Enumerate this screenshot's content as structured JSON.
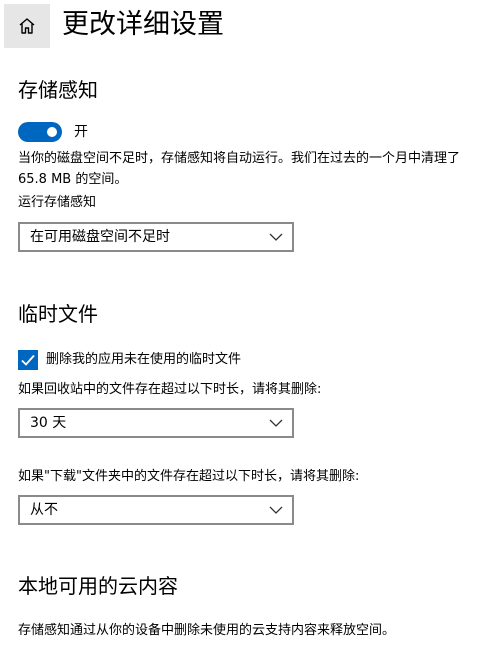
{
  "header": {
    "title": "更改详细设置"
  },
  "storage_sense": {
    "title": "存储感知",
    "toggle_state_label": "开",
    "description": "当你的磁盘空间不足时，存储感知将自动运行。我们在过去的一个月中清理了 65.8 MB 的空间。",
    "run_label": "运行存储感知",
    "run_value": "在可用磁盘空间不足时"
  },
  "temp_files": {
    "title": "临时文件",
    "checkbox_label": "删除我的应用未在使用的临时文件",
    "checkbox_checked": true,
    "recycle_label": "如果回收站中的文件存在超过以下时长，请将其删除:",
    "recycle_value": "30 天",
    "downloads_label": "如果\"下载\"文件夹中的文件存在超过以下时长，请将其删除:",
    "downloads_value": "从不"
  },
  "cloud": {
    "title": "本地可用的云内容",
    "description": "存储感知通过从你的设备中删除未使用的云支持内容来释放空间。"
  },
  "colors": {
    "accent": "#0067c0",
    "home_bg": "#e6e6e6",
    "dropdown_border": "#8a8a8a"
  }
}
